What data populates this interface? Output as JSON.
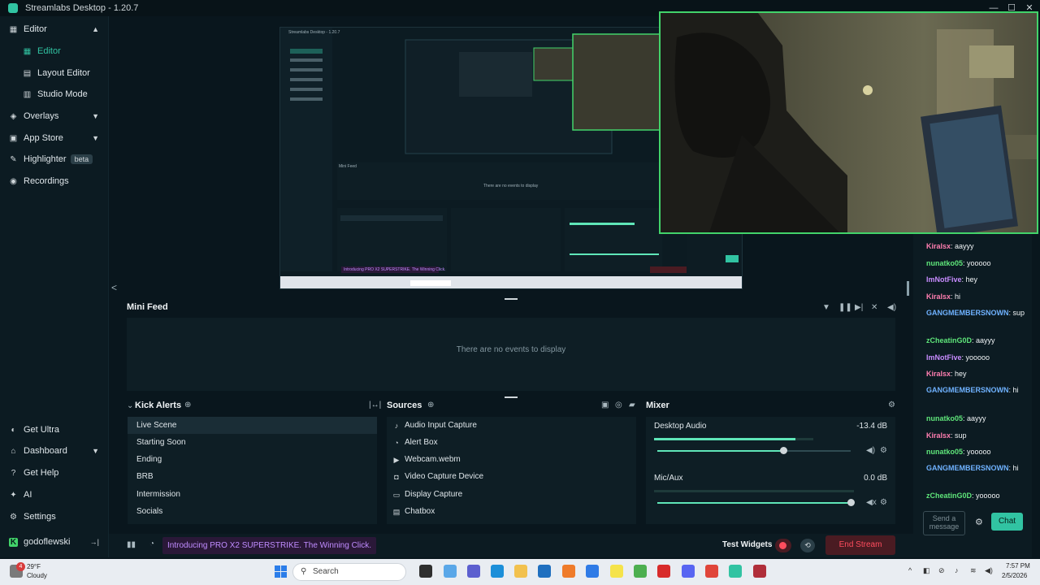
{
  "window": {
    "title": "Streamlabs Desktop - 1.20.7",
    "minimize": "—",
    "maximize": "☐",
    "close": "✕"
  },
  "sidebar": {
    "items": [
      {
        "label": "Editor",
        "chevron": "▲"
      },
      {
        "label": "Editor",
        "active": true
      },
      {
        "label": "Layout Editor"
      },
      {
        "label": "Studio Mode"
      },
      {
        "label": "Overlays",
        "chevron": "▼"
      },
      {
        "label": "App Store",
        "chevron": "▼"
      },
      {
        "label": "Highlighter",
        "badge": "beta"
      },
      {
        "label": "Recordings"
      }
    ],
    "bottom": [
      {
        "label": "Get Ultra"
      },
      {
        "label": "Dashboard",
        "chevron": "▼"
      },
      {
        "label": "Get Help"
      },
      {
        "label": "AI"
      },
      {
        "label": "Settings"
      }
    ],
    "user": {
      "name": "godoflewski",
      "logout": "→|"
    }
  },
  "minifeed": {
    "title": "Mini Feed",
    "empty": "There are no events to display"
  },
  "scenes": {
    "title": "Kick Alerts",
    "items": [
      "Live Scene",
      "Starting Soon",
      "Ending",
      "BRB",
      "Intermission",
      "Socials"
    ],
    "selected": 0
  },
  "sources": {
    "title": "Sources",
    "items": [
      {
        "label": "Audio Input Capture",
        "icon": "microphone-icon"
      },
      {
        "label": "Alert Box",
        "icon": "bell-icon"
      },
      {
        "label": "Webcam.webm",
        "icon": "video-icon"
      },
      {
        "label": "Video Capture Device",
        "icon": "camera-icon"
      },
      {
        "label": "Display Capture",
        "icon": "monitor-icon"
      },
      {
        "label": "Chatbox",
        "icon": "chat-icon"
      }
    ]
  },
  "mixer": {
    "title": "Mixer",
    "channels": [
      {
        "name": "Desktop Audio",
        "db": "-13.4 dB",
        "meter_level": 0.89,
        "volume": 0.65
      },
      {
        "name": "Mic/Aux",
        "db": "0.0 dB",
        "meter_level": 0.0,
        "volume": 1.0
      }
    ]
  },
  "bottombar": {
    "promo": "Introducing PRO X2 SUPERSTRIKE. The Winning Click.",
    "test_widgets": "Test Widgets",
    "end_stream": "End Stream"
  },
  "chat": {
    "messages": [
      {
        "user": "Kiralsx",
        "text": "aayyy",
        "color": "#ff7eb0"
      },
      {
        "user": "nunatko05",
        "text": "yooooo",
        "color": "#5fe67a"
      },
      {
        "user": "ImNotFive",
        "text": "hey",
        "color": "#c88cff"
      },
      {
        "user": "Kiralsx",
        "text": "hi",
        "color": "#ff7eb0"
      },
      {
        "user": "GANGMEMBERSNOWN",
        "text": "sup",
        "color": "#6fb2ff"
      },
      {
        "user": "zCheatinG0D",
        "text": "aayyy",
        "color": "#5fe67a"
      },
      {
        "user": "ImNotFive",
        "text": "yooooo",
        "color": "#c88cff"
      },
      {
        "user": "Kiralsx",
        "text": "hey",
        "color": "#ff7eb0"
      },
      {
        "user": "GANGMEMBERSNOWN",
        "text": "hi",
        "color": "#6fb2ff"
      },
      {
        "user": "nunatko05",
        "text": "aayyy",
        "color": "#5fe67a"
      },
      {
        "user": "Kiralsx",
        "text": "sup",
        "color": "#ff7eb0"
      },
      {
        "user": "nunatko05",
        "text": "yooooo",
        "color": "#5fe67a"
      },
      {
        "user": "GANGMEMBERSNOWN",
        "text": "hi",
        "color": "#6fb2ff"
      },
      {
        "user": "zCheatinG0D",
        "text": "yooooo",
        "color": "#5fe67a"
      }
    ],
    "input_placeholder": "Send a message",
    "send_label": "Chat"
  },
  "taskbar": {
    "weather_temp": "29°F",
    "weather_desc": "Cloudy",
    "search_placeholder": "Search",
    "time": "7:57 PM",
    "date": "2/5/2026",
    "notification_badge": "4"
  },
  "colors": {
    "accent": "#31c3a2",
    "danger": "#ff4d5e",
    "promo": "#c08cff",
    "webcam_border": "#42d36a"
  }
}
